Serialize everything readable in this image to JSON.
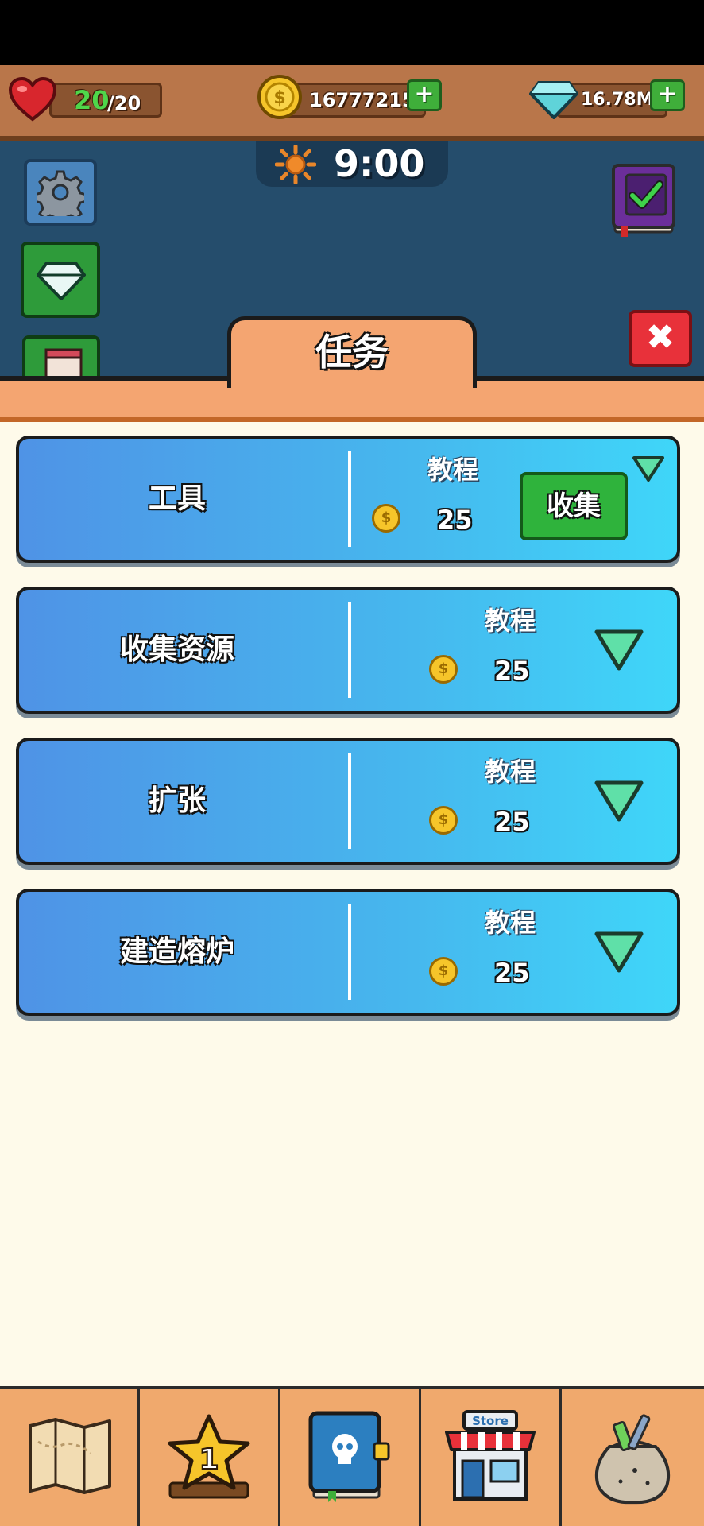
{
  "resources": {
    "health": {
      "current": "20",
      "max": "/20"
    },
    "coins": "16777215",
    "gems": "16.78M",
    "plus": "+"
  },
  "clock": {
    "time": "9:00"
  },
  "panel": {
    "title": "任务",
    "close": "✖"
  },
  "tasks": [
    {
      "name": "工具",
      "type": "教程",
      "reward": "25",
      "action": "收集",
      "completed": true
    },
    {
      "name": "收集资源",
      "type": "教程",
      "reward": "25",
      "completed": false
    },
    {
      "name": "扩张",
      "type": "教程",
      "reward": "25",
      "completed": false
    },
    {
      "name": "建造熔炉",
      "type": "教程",
      "reward": "25",
      "completed": false
    }
  ],
  "nav": {
    "items": [
      "map-icon",
      "star-level-icon",
      "skull-book-icon",
      "store-icon",
      "sack-icon"
    ],
    "star_level": "1",
    "store_label": "Store",
    "active_index": 1
  },
  "colors": {
    "accent": "#2fb33c",
    "close": "#e8313a",
    "card_start": "#4f93e6",
    "card_end": "#3fd6f9"
  }
}
